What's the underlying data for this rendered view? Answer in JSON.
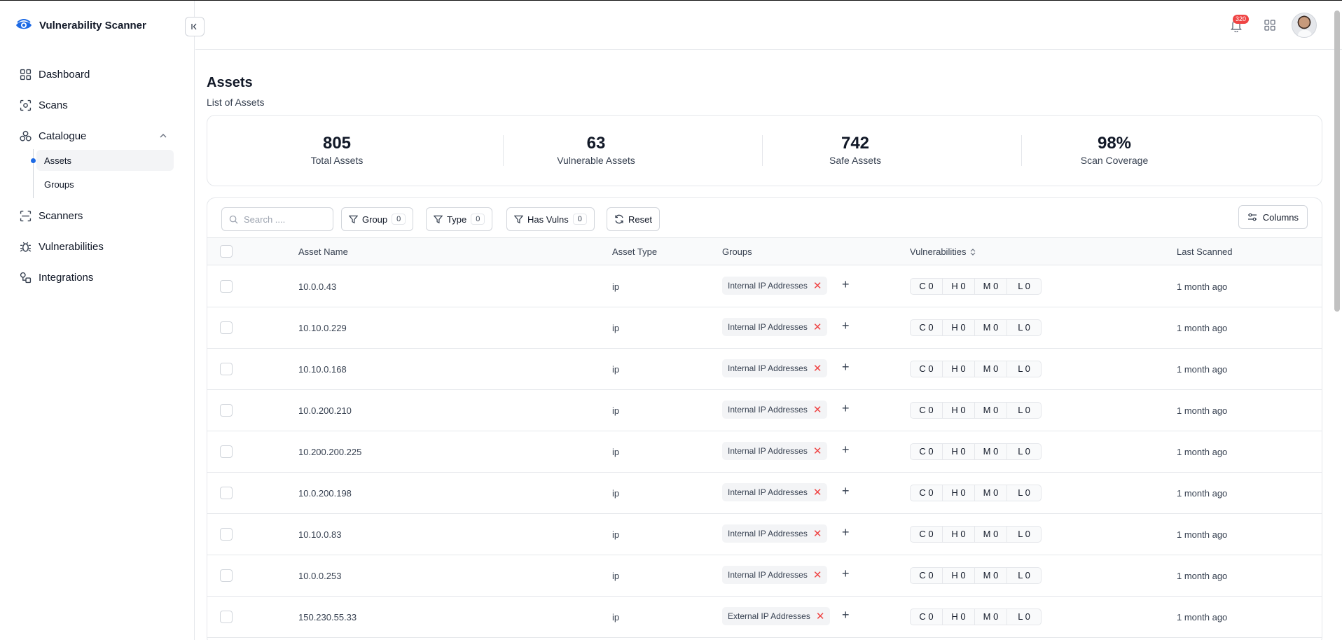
{
  "app": {
    "title": "Vulnerability Scanner"
  },
  "sidebar": {
    "items": [
      {
        "label": "Dashboard",
        "icon": "grid-icon"
      },
      {
        "label": "Scans",
        "icon": "scan-icon"
      },
      {
        "label": "Catalogue",
        "icon": "catalogue-icon"
      },
      {
        "label": "Scanners",
        "icon": "scanner-icon"
      },
      {
        "label": "Vulnerabilities",
        "icon": "bug-icon"
      },
      {
        "label": "Integrations",
        "icon": "integrations-icon"
      }
    ],
    "sub_items": [
      {
        "label": "Assets",
        "active": true
      },
      {
        "label": "Groups",
        "active": false
      }
    ]
  },
  "topbar": {
    "notification_count": "320"
  },
  "page": {
    "title": "Assets",
    "subtitle": "List of Assets"
  },
  "stats": [
    {
      "value": "805",
      "label": "Total Assets"
    },
    {
      "value": "63",
      "label": "Vulnerable Assets"
    },
    {
      "value": "742",
      "label": "Safe Assets"
    },
    {
      "value": "98%",
      "label": "Scan Coverage"
    }
  ],
  "toolbar": {
    "search_placeholder": "Search ....",
    "filters": [
      {
        "label": "Group",
        "count": "0"
      },
      {
        "label": "Type",
        "count": "0"
      },
      {
        "label": "Has Vulns",
        "count": "0"
      }
    ],
    "reset_label": "Reset",
    "columns_label": "Columns"
  },
  "table": {
    "headers": {
      "name": "Asset Name",
      "type": "Asset Type",
      "groups": "Groups",
      "vulns": "Vulnerabilities",
      "last": "Last Scanned"
    },
    "rows": [
      {
        "name": "10.0.0.43",
        "type": "ip",
        "group": "Internal IP Addresses",
        "c": "C 0",
        "h": "H 0",
        "m": "M 0",
        "l": "L 0",
        "last": "1 month ago"
      },
      {
        "name": "10.10.0.229",
        "type": "ip",
        "group": "Internal IP Addresses",
        "c": "C 0",
        "h": "H 0",
        "m": "M 0",
        "l": "L 0",
        "last": "1 month ago"
      },
      {
        "name": "10.10.0.168",
        "type": "ip",
        "group": "Internal IP Addresses",
        "c": "C 0",
        "h": "H 0",
        "m": "M 0",
        "l": "L 0",
        "last": "1 month ago"
      },
      {
        "name": "10.0.200.210",
        "type": "ip",
        "group": "Internal IP Addresses",
        "c": "C 0",
        "h": "H 0",
        "m": "M 0",
        "l": "L 0",
        "last": "1 month ago"
      },
      {
        "name": "10.200.200.225",
        "type": "ip",
        "group": "Internal IP Addresses",
        "c": "C 0",
        "h": "H 0",
        "m": "M 0",
        "l": "L 0",
        "last": "1 month ago"
      },
      {
        "name": "10.0.200.198",
        "type": "ip",
        "group": "Internal IP Addresses",
        "c": "C 0",
        "h": "H 0",
        "m": "M 0",
        "l": "L 0",
        "last": "1 month ago"
      },
      {
        "name": "10.10.0.83",
        "type": "ip",
        "group": "Internal IP Addresses",
        "c": "C 0",
        "h": "H 0",
        "m": "M 0",
        "l": "L 0",
        "last": "1 month ago"
      },
      {
        "name": "10.0.0.253",
        "type": "ip",
        "group": "Internal IP Addresses",
        "c": "C 0",
        "h": "H 0",
        "m": "M 0",
        "l": "L 0",
        "last": "1 month ago"
      },
      {
        "name": "150.230.55.33",
        "type": "ip",
        "group": "External IP Addresses",
        "c": "C 0",
        "h": "H 0",
        "m": "M 0",
        "l": "L 0",
        "last": "1 month ago"
      }
    ]
  },
  "colors": {
    "accent": "#1d6ae5",
    "danger": "#ef4444"
  }
}
